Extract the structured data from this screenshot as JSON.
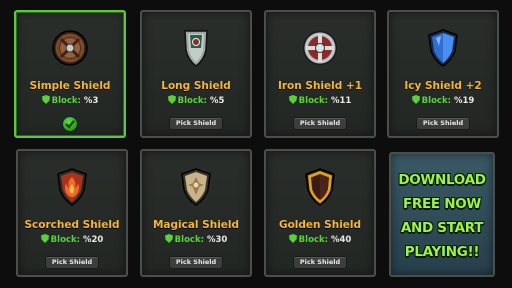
{
  "colors": {
    "name": "#f5b63a",
    "block_label": "#59d23a",
    "selected_border": "#5fc83a",
    "promo_text": "#9cf542"
  },
  "shields": [
    {
      "name": "Simple Shield",
      "block_label": "Block:",
      "block_value": "%3",
      "selected": true,
      "icon": "round-wooden-shield-icon"
    },
    {
      "name": "Long Shield",
      "block_label": "Block:",
      "block_value": "%5",
      "button": "Pick Shield",
      "icon": "long-shield-icon"
    },
    {
      "name": "Iron Shield +1",
      "block_label": "Block:",
      "block_value": "%11",
      "button": "Pick Shield",
      "icon": "round-iron-shield-icon"
    },
    {
      "name": "Icy Shield +2",
      "block_label": "Block:",
      "block_value": "%19",
      "button": "Pick Shield",
      "icon": "icy-shield-icon"
    },
    {
      "name": "Scorched Shield",
      "block_label": "Block:",
      "block_value": "%20",
      "button": "Pick Shield",
      "icon": "scorched-shield-icon"
    },
    {
      "name": "Magical Shield",
      "block_label": "Block:",
      "block_value": "%30",
      "button": "Pick Shield",
      "icon": "magical-shield-icon"
    },
    {
      "name": "Golden Shield",
      "block_label": "Block:",
      "block_value": "%40",
      "button": "Pick Shield",
      "icon": "golden-shield-icon"
    }
  ],
  "promo": {
    "lines": [
      "DOWNLOAD",
      "FREE NOW",
      "AND START",
      "PLAYING!!"
    ]
  }
}
